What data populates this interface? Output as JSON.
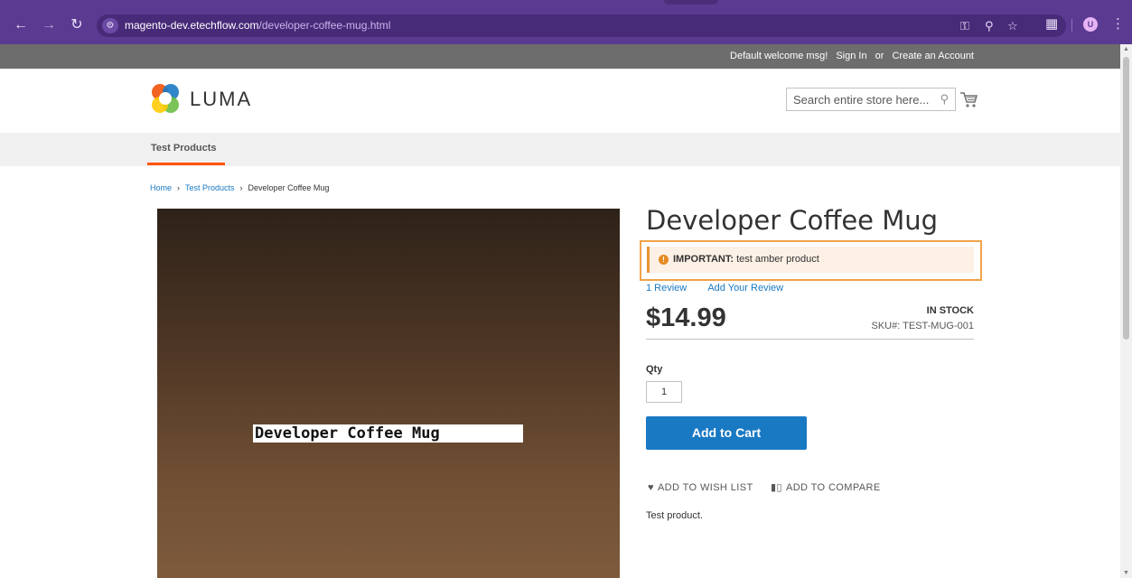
{
  "browser": {
    "url_host": "magento-dev.etechflow.com",
    "url_path": "/developer-coffee-mug.html",
    "avatar_letter": "U"
  },
  "header": {
    "welcome": "Default welcome msg!",
    "sign_in": "Sign In",
    "or": "or",
    "create_account": "Create an Account",
    "logo_text": "LUMA",
    "search_placeholder": "Search entire store here..."
  },
  "nav": {
    "items": [
      {
        "label": "Test Products"
      }
    ]
  },
  "breadcrumb": {
    "home": "Home",
    "category": "Test Products",
    "current": "Developer Coffee Mug"
  },
  "product": {
    "image_label": "Developer Coffee Mug",
    "title": "Developer Coffee Mug",
    "notice_label": "IMPORTANT:",
    "notice_text": "test amber product",
    "review_count": "1 Review",
    "add_review": "Add Your Review",
    "price": "$14.99",
    "stock": "IN STOCK",
    "sku_label": "SKU#:",
    "sku": "TEST-MUG-001",
    "qty_label": "Qty",
    "qty_value": "1",
    "add_to_cart": "Add to Cart",
    "wish_list": "ADD TO WISH LIST",
    "compare": "ADD TO COMPARE",
    "description": "Test product."
  },
  "colors": {
    "browser_chrome": "#5b3a91",
    "panel": "#6d6d6d",
    "link": "#1979c3",
    "button": "#1979c3",
    "nav_accent": "#ff5501",
    "notice_border": "#eb9334",
    "notice_bg": "#fdf0e5"
  }
}
